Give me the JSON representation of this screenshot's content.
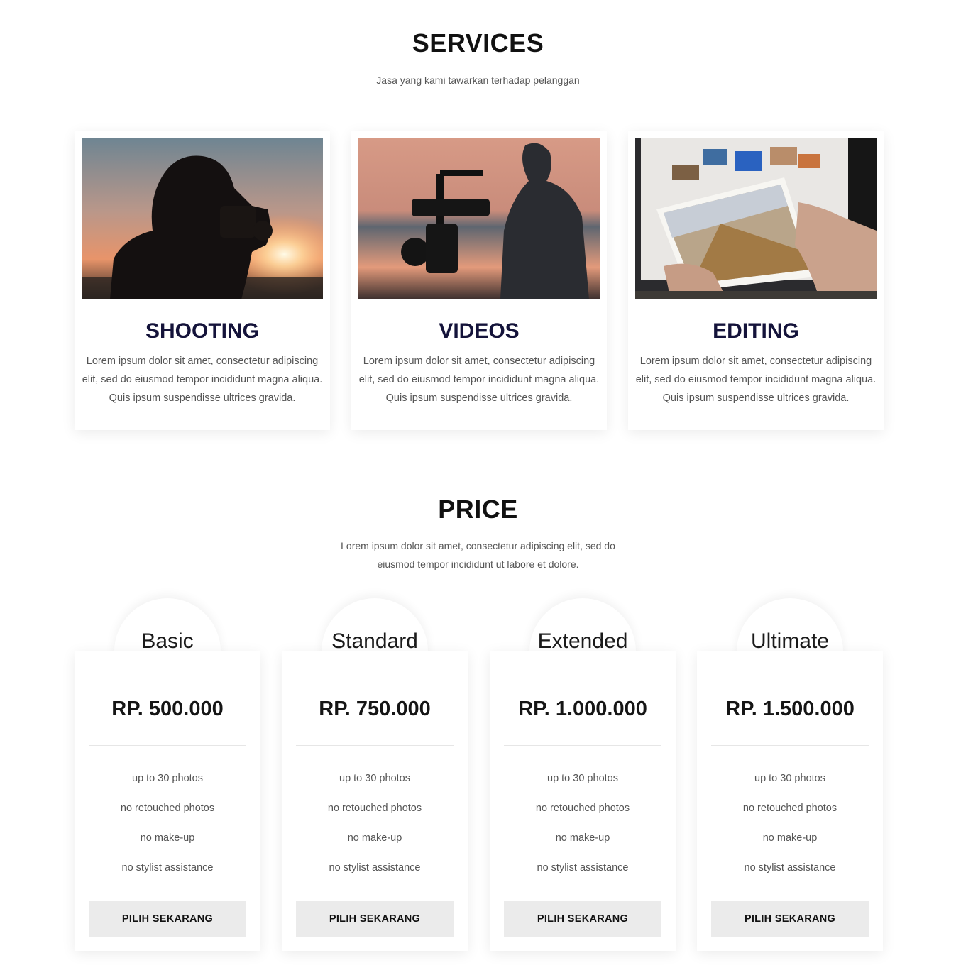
{
  "services": {
    "title": "SERVICES",
    "subtitle": "Jasa yang kami tawarkan terhadap pelanggan",
    "cards": [
      {
        "title": "SHOOTING",
        "description": "Lorem ipsum dolor sit amet, consectetur adipiscing elit, sed do eiusmod tempor incididunt magna aliqua. Quis ipsum suspendisse ultrices gravida.",
        "image": "photographer-silhouette-sunset"
      },
      {
        "title": "VIDEOS",
        "description": "Lorem ipsum dolor sit amet, consectetur adipiscing elit, sed do eiusmod tempor incididunt magna aliqua. Quis ipsum suspendisse ultrices gravida.",
        "image": "videographer-with-gimbal"
      },
      {
        "title": "EDITING",
        "description": "Lorem ipsum dolor sit amet, consectetur adipiscing elit, sed do eiusmod tempor incididunt magna aliqua. Quis ipsum suspendisse ultrices gravida.",
        "image": "hands-holding-printed-photo"
      }
    ]
  },
  "price": {
    "title": "PRICE",
    "subtitle_line1": "Lorem ipsum dolor sit amet, consectetur adipiscing elit, sed do",
    "subtitle_line2": "eiusmod tempor incididunt ut labore et dolore.",
    "plans": [
      {
        "name": "Basic",
        "amount": "RP. 500.000",
        "features": [
          "up to 30 photos",
          "no retouched photos",
          "no make-up",
          "no stylist assistance"
        ],
        "button": "PILIH SEKARANG"
      },
      {
        "name": "Standard",
        "amount": "RP. 750.000",
        "features": [
          "up to 30 photos",
          "no retouched photos",
          "no make-up",
          "no stylist assistance"
        ],
        "button": "PILIH SEKARANG"
      },
      {
        "name": "Extended",
        "amount": "RP. 1.000.000",
        "features": [
          "up to 30 photos",
          "no retouched photos",
          "no make-up",
          "no stylist assistance"
        ],
        "button": "PILIH SEKARANG"
      },
      {
        "name": "Ultimate",
        "amount": "RP. 1.500.000",
        "features": [
          "up to 30 photos",
          "no retouched photos",
          "no make-up",
          "no stylist assistance"
        ],
        "button": "PILIH SEKARANG"
      }
    ]
  },
  "colors": {
    "heading": "#111111",
    "card_title": "#14133a",
    "body_text": "#555555",
    "button_bg": "#ebebeb"
  }
}
